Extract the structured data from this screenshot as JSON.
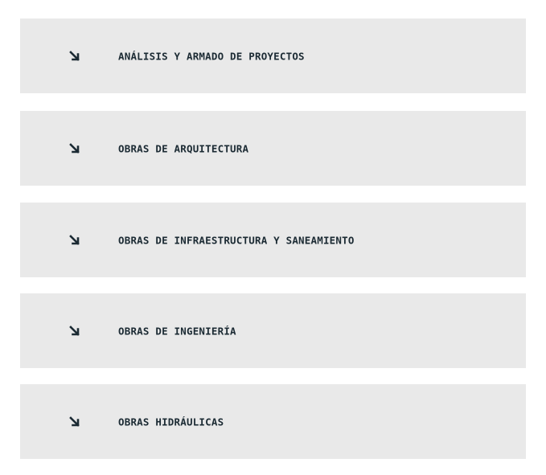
{
  "colors": {
    "item_background": "#e9e9e9",
    "text": "#1b2a33",
    "page_background": "#ffffff"
  },
  "items": [
    {
      "icon": "arrow-down-right-icon",
      "label": "ANÁLISIS Y ARMADO DE PROYECTOS"
    },
    {
      "icon": "arrow-down-right-icon",
      "label": "OBRAS DE ARQUITECTURA"
    },
    {
      "icon": "arrow-down-right-icon",
      "label": "OBRAS DE INFRAESTRUCTURA Y SANEAMIENTO"
    },
    {
      "icon": "arrow-down-right-icon",
      "label": "OBRAS DE INGENIERÍA"
    },
    {
      "icon": "arrow-down-right-icon",
      "label": "OBRAS HIDRÁULICAS"
    }
  ]
}
